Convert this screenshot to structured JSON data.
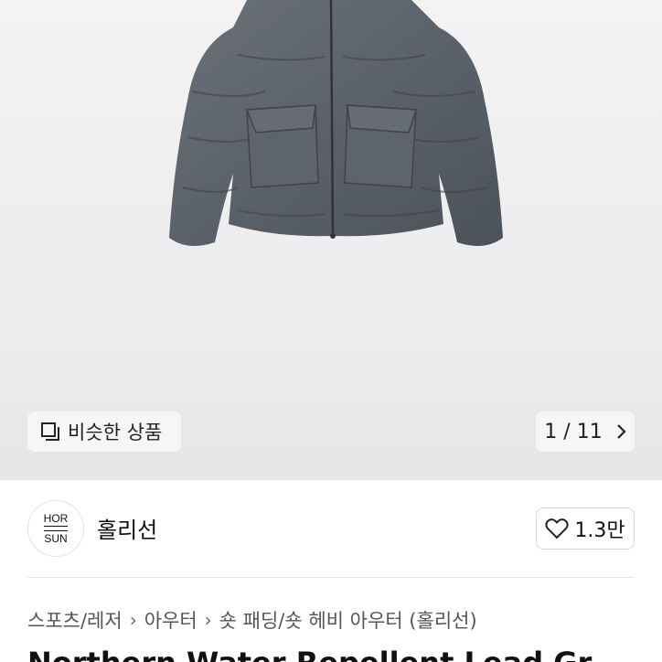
{
  "gallery": {
    "similar_label": "비슷한 상품",
    "similar_icon": "similar-products-icon",
    "pager_text": "1 / 11",
    "next_icon": "chevron-right-icon"
  },
  "brand": {
    "logo_top": "HOR",
    "logo_bottom": "SUN",
    "name": "홀리선",
    "like_icon": "heart-outline-icon",
    "like_count": "1.3만"
  },
  "breadcrumb": {
    "items": [
      "스포츠/레저",
      "아우터",
      "숏 패딩/숏 헤비 아우터 (홀리선)"
    ],
    "separator_icon": "chevron-right-icon"
  },
  "product": {
    "title_partial": "Northern Water Repellent Lead Gr"
  },
  "colors": {
    "jacket": "#5a6068",
    "hero_bg": "#efeff0"
  }
}
